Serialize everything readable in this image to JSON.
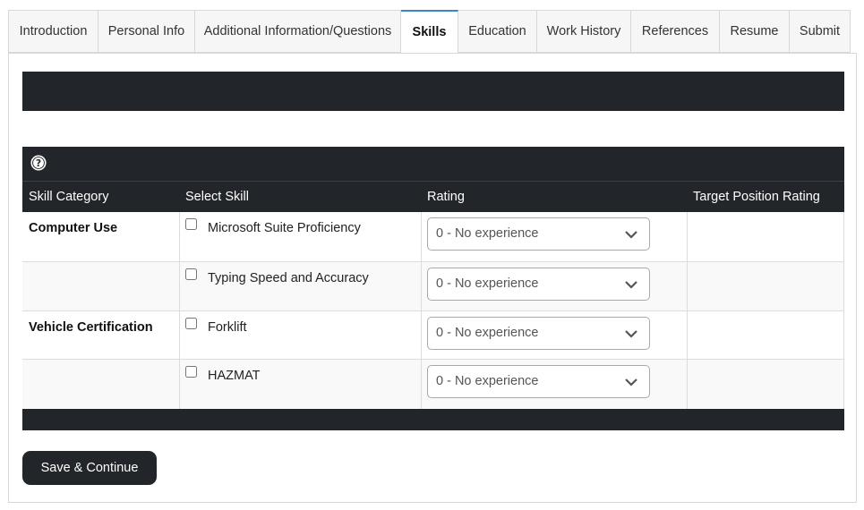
{
  "tabs": [
    {
      "label": "Introduction"
    },
    {
      "label": "Personal Info"
    },
    {
      "label": "Additional Information/Questions"
    },
    {
      "label": "Skills",
      "active": true
    },
    {
      "label": "Education"
    },
    {
      "label": "Work History"
    },
    {
      "label": "References"
    },
    {
      "label": "Resume"
    },
    {
      "label": "Submit"
    }
  ],
  "table": {
    "help_icon": "question-circle-icon",
    "columns": [
      "Skill Category",
      "Select Skill",
      "Rating",
      "Target Position Rating"
    ],
    "rows": [
      {
        "category": "Computer Use",
        "skill": "Microsoft Suite Proficiency",
        "checked": false,
        "rating": "0 - No experience",
        "target_rating": ""
      },
      {
        "category": "",
        "skill": "Typing Speed and Accuracy",
        "checked": false,
        "rating": "0 - No experience",
        "target_rating": ""
      },
      {
        "category": "Vehicle Certification",
        "skill": "Forklift",
        "checked": false,
        "rating": "0 - No experience",
        "target_rating": ""
      },
      {
        "category": "",
        "skill": "HAZMAT",
        "checked": false,
        "rating": "0 - No experience",
        "target_rating": ""
      }
    ]
  },
  "actions": {
    "save_label": "Save & Continue"
  },
  "colors": {
    "dark_bar": "#222529",
    "active_tab_accent": "#3a86c8"
  }
}
